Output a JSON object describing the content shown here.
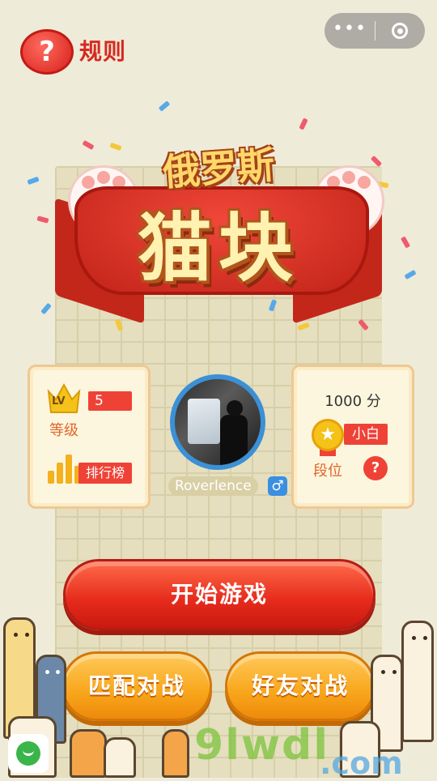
{
  "header": {
    "rules_icon": "help-question-icon",
    "rules_label": "规则",
    "capsule_more_icon": "•••",
    "capsule_close_icon": "target-circle-icon"
  },
  "logo": {
    "title_top": "俄罗斯",
    "title_main": "猫块"
  },
  "player": {
    "level_badge": "LV",
    "level": "5",
    "level_label": "等级",
    "rank_button": "排行榜",
    "username": "Roverlence",
    "gender_icon": "♂",
    "score": "1000 分",
    "tier": "小白",
    "tier_label": "段位",
    "tier_help": "?"
  },
  "buttons": {
    "start": "开始游戏",
    "match": "匹配对战",
    "friend": "好友对战"
  },
  "watermark": {
    "main": "9lwdl",
    "domain": ".com"
  },
  "colors": {
    "background": "#efebd9",
    "primary_red": "#ef4237",
    "accent_orange": "#f8a61b",
    "avatar_ring": "#3b90d6"
  }
}
